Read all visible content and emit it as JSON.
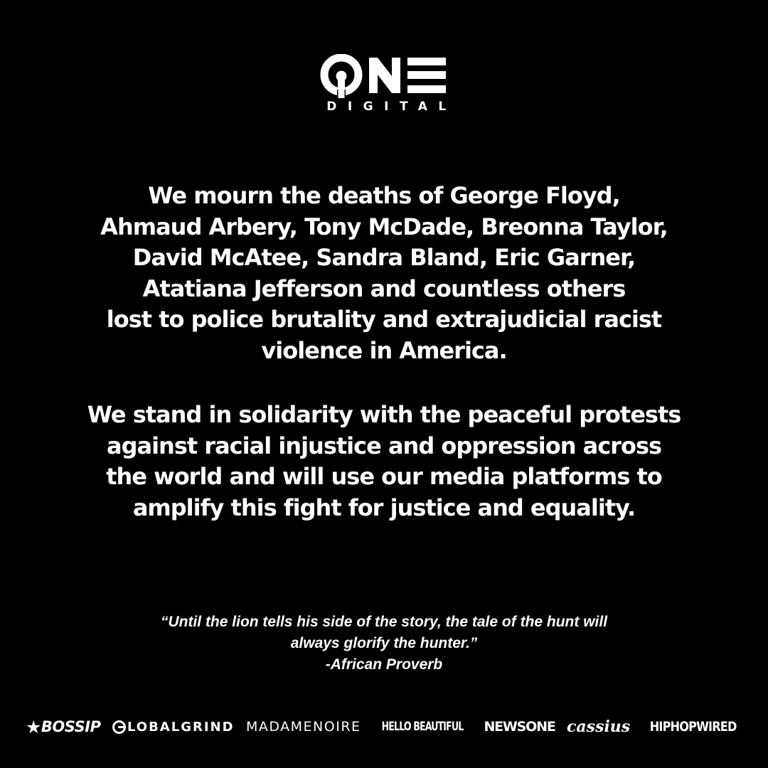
{
  "logo": {
    "wordmark": "ONE",
    "subtitle": "DIGITAL"
  },
  "statement": {
    "paragraph1": [
      "We mourn the deaths of George Floyd,",
      "Ahmaud Arbery, Tony McDade, Breonna Taylor,",
      "David McAtee, Sandra Bland, Eric Garner,",
      "Atatiana Jefferson and countless others",
      "lost to police brutality and extrajudicial racist",
      "violence in America."
    ],
    "paragraph2": [
      "We stand in solidarity with the peaceful protests",
      "against racial injustice and oppression across",
      "the world and will use our media platforms to",
      "amplify this fight for justice and equality."
    ]
  },
  "quote": {
    "lines": [
      "“Until the lion tells his side of the story, the tale of the hunt will",
      "always glorify the hunter.”",
      "-African Proverb"
    ]
  },
  "brands": {
    "bossip": "BOSSIP",
    "globalgrind": "LOBALGRIND",
    "madamenoire": "MADAMENOIRE",
    "hellobeautiful": "HELLO BEAUTIFUL",
    "newsone": "NEWSONE",
    "cassius": "cassius",
    "hiphopwired": "HIPHOPWIRED"
  },
  "colors": {
    "background": "#000000",
    "text": "#ffffff"
  }
}
